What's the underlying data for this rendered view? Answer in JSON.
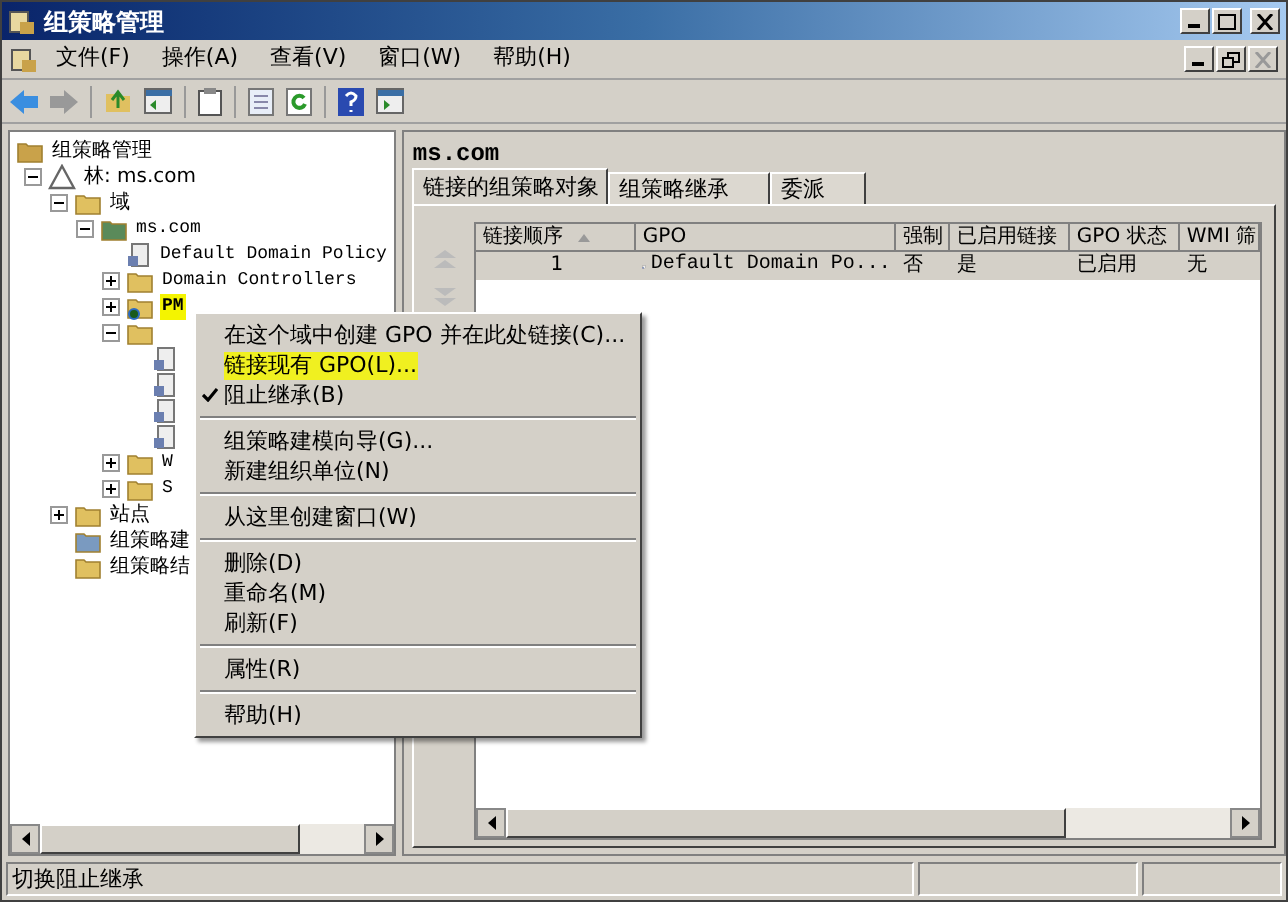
{
  "window": {
    "title": "组策略管理"
  },
  "menu_bar": [
    "文件(F)",
    "操作(A)",
    "查看(V)",
    "窗口(W)",
    "帮助(H)"
  ],
  "tree": [
    {
      "label": "组策略管理",
      "kind": "console",
      "children": [
        {
          "label": "林: ms.com",
          "kind": "forest",
          "expanded": true,
          "children": [
            {
              "label": "域",
              "kind": "folder",
              "expanded": true,
              "children": [
                {
                  "label": "ms.com",
                  "kind": "domain",
                  "expanded": true,
                  "children": [
                    {
                      "label": "Default Domain Policy",
                      "kind": "gpo"
                    },
                    {
                      "label": "Domain Controllers",
                      "kind": "folder",
                      "expanded": false
                    },
                    {
                      "label": "PM",
                      "kind": "blocked",
                      "expanded": false,
                      "highlighted": true
                    },
                    {
                      "kind": "folder",
                      "expanded": true,
                      "children": [
                        {
                          "kind": "gpo"
                        },
                        {
                          "kind": "gpo"
                        },
                        {
                          "kind": "gpo"
                        },
                        {
                          "kind": "gpo"
                        }
                      ]
                    },
                    {
                      "label": "W",
                      "kind": "folder",
                      "expanded": false
                    },
                    {
                      "label": "S",
                      "kind": "folder",
                      "expanded": false
                    }
                  ]
                }
              ]
            },
            {
              "label": "站点",
              "kind": "folder",
              "expanded": false
            },
            {
              "label": "组策略建",
              "kind": "modeling"
            },
            {
              "label": "组策略结",
              "kind": "folder"
            }
          ]
        }
      ]
    }
  ],
  "details": {
    "title": "ms.com",
    "tabs": [
      {
        "label": "链接的组策略对象",
        "selected": true
      },
      {
        "label": "组策略继承",
        "selected": false
      },
      {
        "label": "委派",
        "selected": false
      }
    ],
    "table": {
      "columns": [
        "链接顺序",
        "GPO",
        "强制",
        "已启用链接",
        "GPO 状态",
        "WMI 筛"
      ],
      "rows": [
        [
          "1",
          "Default Domain Po...",
          "否",
          "是",
          "已启用",
          "无"
        ]
      ]
    }
  },
  "context_menu": [
    {
      "kind": "item",
      "label": "在这个域中创建 GPO 并在此处链接(C)...",
      "checked": false,
      "highlighted": false
    },
    {
      "kind": "item",
      "label": "链接现有 GPO(L)...",
      "checked": false,
      "highlighted": true
    },
    {
      "kind": "item",
      "label": "阻止继承(B)",
      "checked": true,
      "highlighted": false
    },
    {
      "kind": "separator"
    },
    {
      "kind": "item",
      "label": "组策略建模向导(G)...",
      "checked": false,
      "highlighted": false
    },
    {
      "kind": "item",
      "label": "新建组织单位(N)",
      "checked": false,
      "highlighted": false
    },
    {
      "kind": "separator"
    },
    {
      "kind": "item",
      "label": "从这里创建窗口(W)",
      "checked": false,
      "highlighted": false
    },
    {
      "kind": "separator"
    },
    {
      "kind": "item",
      "label": "删除(D)",
      "checked": false,
      "highlighted": false
    },
    {
      "kind": "item",
      "label": "重命名(M)",
      "checked": false,
      "highlighted": false
    },
    {
      "kind": "item",
      "label": "刷新(F)",
      "checked": false,
      "highlighted": false
    },
    {
      "kind": "separator"
    },
    {
      "kind": "item",
      "label": "属性(R)",
      "checked": false,
      "highlighted": false
    },
    {
      "kind": "separator"
    },
    {
      "kind": "item",
      "label": "帮助(H)",
      "checked": false,
      "highlighted": false
    }
  ],
  "status_bar": {
    "text": "切换阻止继承"
  }
}
